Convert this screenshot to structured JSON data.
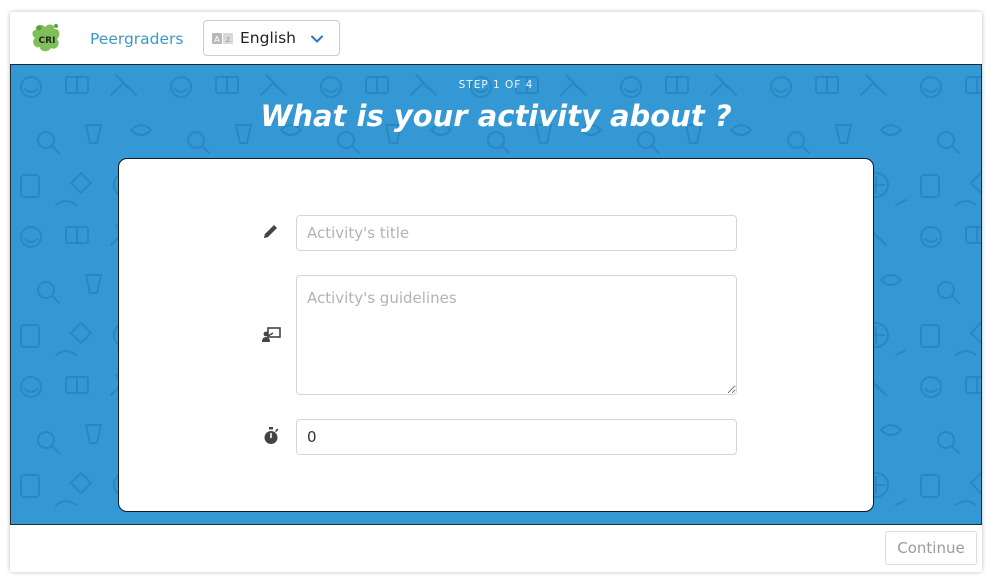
{
  "header": {
    "logo_text": "CRI",
    "brand_label": "Peergraders",
    "language": {
      "selected": "English",
      "icon": "language-icon"
    }
  },
  "hero": {
    "step": "STEP 1 OF 4",
    "title": "What is your activity about ?"
  },
  "form": {
    "title_field": {
      "placeholder": "Activity's title",
      "value": "",
      "icon": "pencil-icon"
    },
    "guidelines_field": {
      "placeholder": "Activity's guidelines",
      "value": "",
      "icon": "presentation-icon"
    },
    "duration_field": {
      "value": "0",
      "icon": "stopwatch-icon"
    }
  },
  "footer": {
    "continue_label": "Continue"
  },
  "colors": {
    "hero_bg": "#3398d3",
    "brand": "#3b9bc4",
    "accent": "#2a73c9"
  }
}
